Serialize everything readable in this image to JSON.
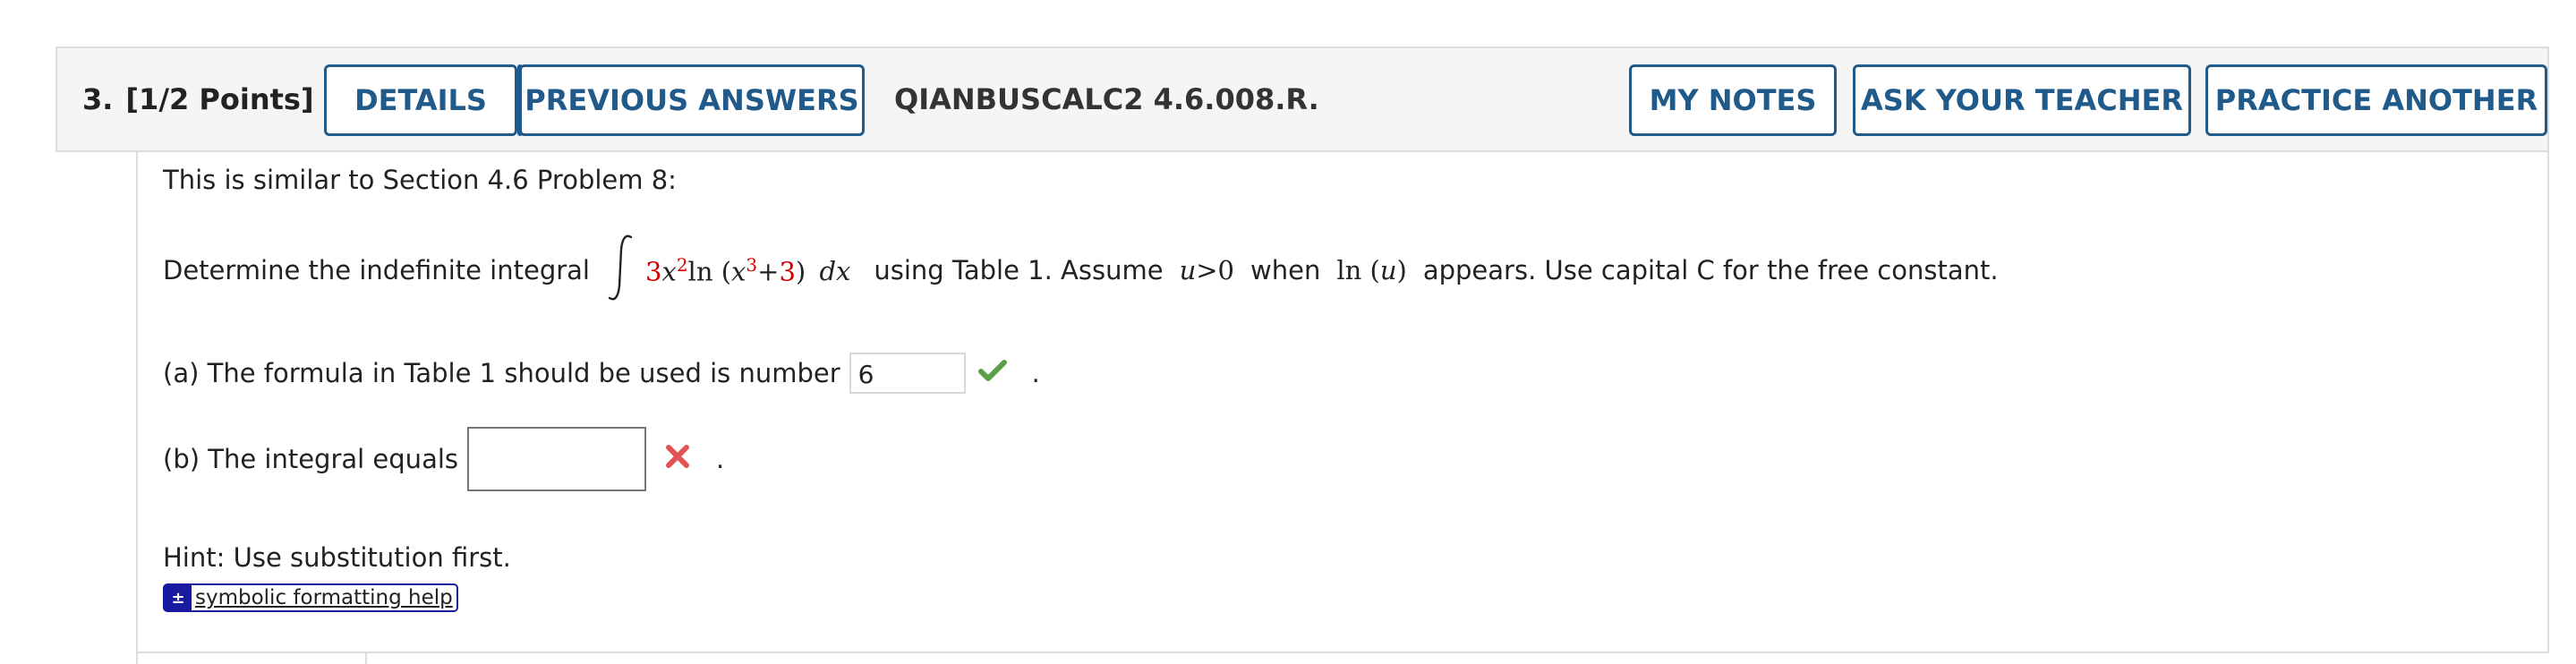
{
  "header": {
    "question_number": "3.",
    "points": "[1/2 Points]",
    "details_label": "DETAILS",
    "previous_answers_label": "PREVIOUS ANSWERS",
    "question_code": "QIANBUSCALC2 4.6.008.R.",
    "my_notes_label": "MY NOTES",
    "ask_teacher_label": "ASK YOUR TEACHER",
    "practice_another_label": "PRACTICE ANOTHER"
  },
  "question": {
    "intro": "This is similar to Section 4.6 Problem 8:",
    "prompt_prefix": "Determine the indefinite integral",
    "integrand": {
      "coef": "3",
      "var1": "x",
      "exp1": "2",
      "fn": "ln",
      "var2": "x",
      "exp2": "3",
      "plus": "+",
      "const": "3",
      "dx": "dx"
    },
    "prompt_using": "using Table 1. Assume",
    "condition_var": "u",
    "condition_rest": ">0",
    "prompt_when": "when",
    "ln_label": "ln",
    "ln_arg": "u",
    "prompt_suffix": "appears. Use capital C for the free constant.",
    "part_a_label": "(a) The formula in Table 1 should be used is number",
    "part_a_value": "6",
    "part_a_status": "correct",
    "part_b_label": "(b) The integral equals",
    "part_b_value": "",
    "part_b_status": "incorrect",
    "period": ".",
    "hint": "Hint: Use substitution first.",
    "help_link_label": "symbolic formatting help"
  },
  "colors": {
    "accent": "#1f5a8a",
    "highlight_red": "#d40000",
    "correct_green": "#5a9e46",
    "incorrect_red": "#e25353",
    "help_blue": "#1a1aa0"
  },
  "icons": {
    "part_a_status_icon": "check-icon",
    "part_b_status_icon": "cross-icon",
    "help_icon": "plus-minus-icon"
  }
}
